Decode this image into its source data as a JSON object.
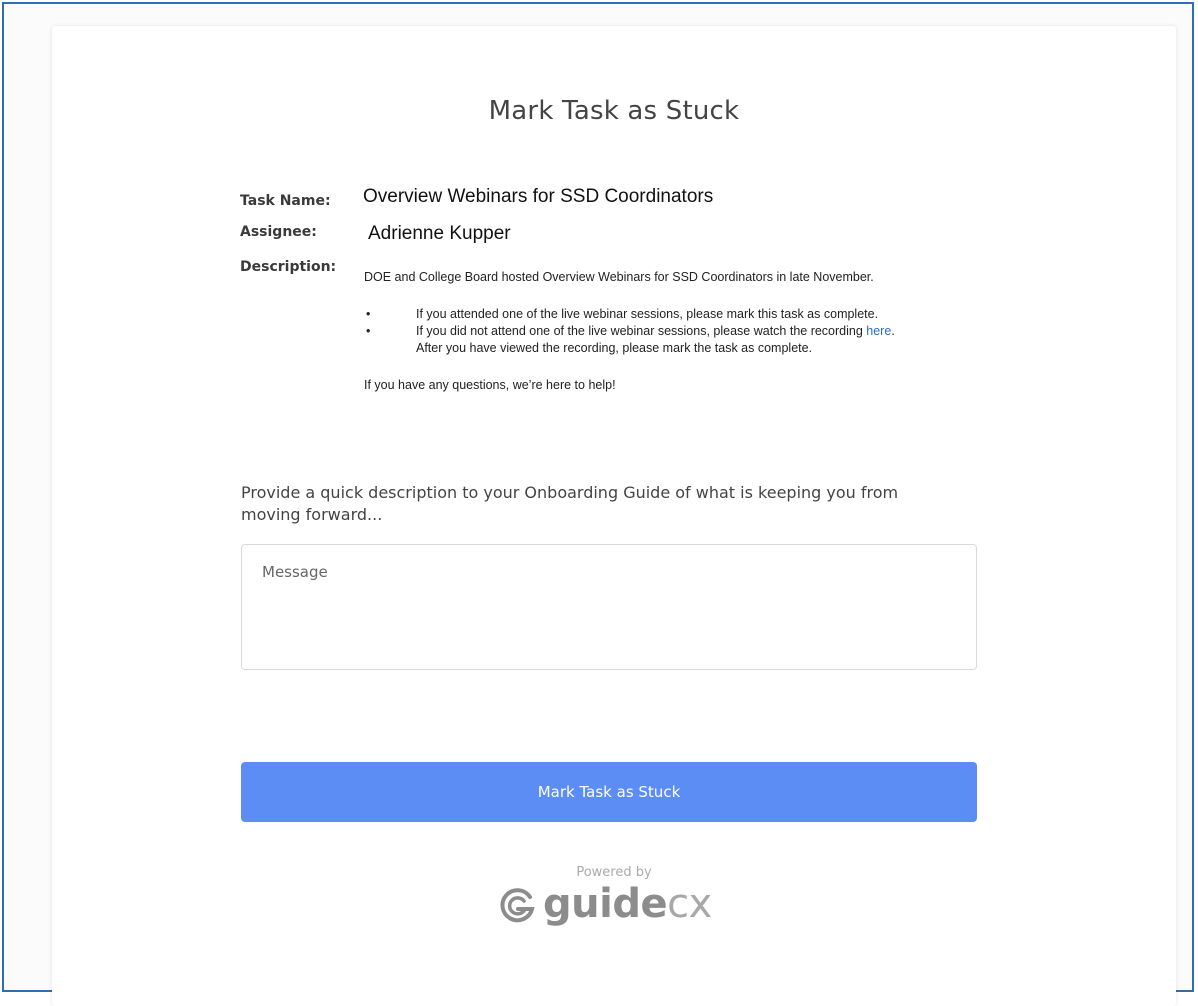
{
  "page": {
    "title": "Mark Task as Stuck"
  },
  "task": {
    "name_label": "Task Name:",
    "name_value": "Overview Webinars for SSD Coordinators",
    "assignee_label": "Assignee:",
    "assignee_value": "Adrienne Kupper",
    "description_label": "Description:",
    "description": {
      "intro": "DOE and College Board hosted Overview Webinars for SSD Coordinators in late November.",
      "bullet_glyph": "•",
      "bullet_1": "If you attended one of the live webinar sessions, please mark this task as complete.",
      "bullet_2_before_link": "If you did not attend one of the live webinar sessions, please watch the recording ",
      "bullet_2_link": "here",
      "bullet_2_after_link": ".",
      "bullet_2_line2": "After you have viewed the recording, please mark the task as complete.",
      "closing": "If you have any questions, we’re here to help!"
    }
  },
  "form": {
    "prompt": "Provide a quick description to your Onboarding Guide of what is keeping you from moving forward...",
    "message_placeholder": "Message",
    "message_value": "",
    "submit_label": "Mark Task as Stuck"
  },
  "footer": {
    "powered_by": "Powered by",
    "logo_text_bold": "guide",
    "logo_text_light": "cx",
    "logo_icon": "guidecx-g-icon"
  },
  "colors": {
    "accent_button": "#5b8df5",
    "link": "#2b6cc4",
    "frame_border": "#2f6fad"
  }
}
